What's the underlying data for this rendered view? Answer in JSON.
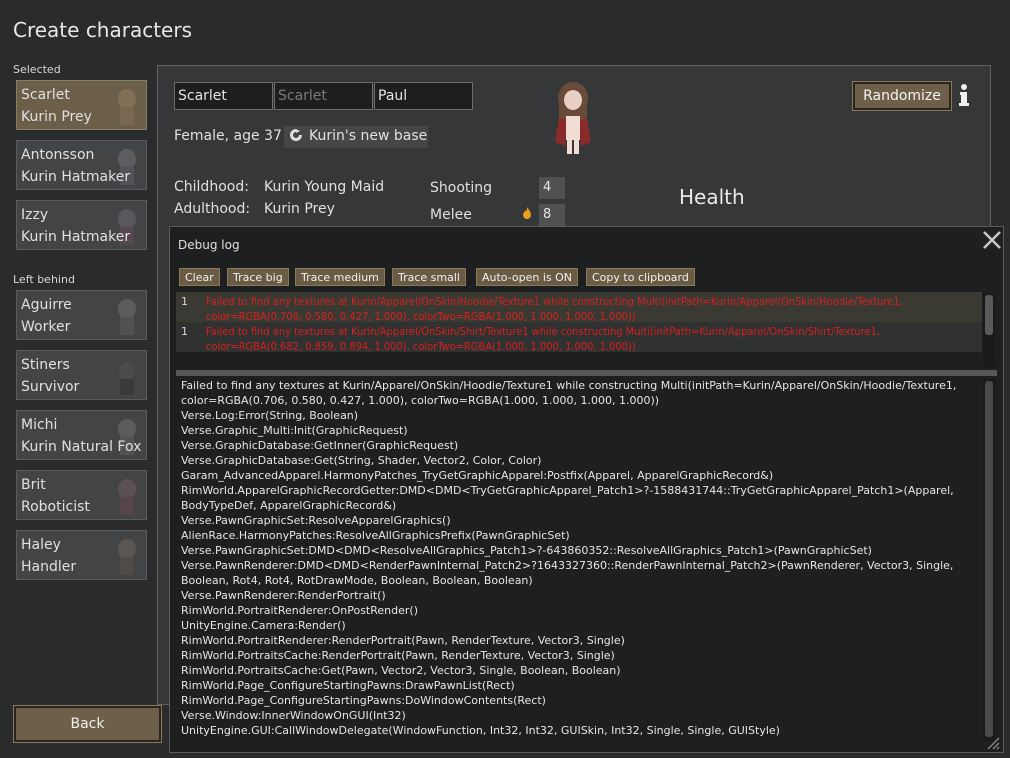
{
  "page": {
    "title": "Create characters"
  },
  "sidebar": {
    "selected_label": "Selected",
    "left_behind_label": "Left behind",
    "selected": [
      {
        "name": "Scarlet",
        "title": "Kurin Prey"
      },
      {
        "name": "Antonsson",
        "title": "Kurin Hatmaker"
      },
      {
        "name": "Izzy",
        "title": "Kurin Hatmaker"
      }
    ],
    "left_behind": [
      {
        "name": "Aguirre",
        "title": "Worker"
      },
      {
        "name": "Stiners",
        "title": "Survivor"
      },
      {
        "name": "Michi",
        "title": "Kurin Natural Fox"
      },
      {
        "name": "Brit",
        "title": "Roboticist"
      },
      {
        "name": "Haley",
        "title": "Handler"
      }
    ],
    "back_label": "Back"
  },
  "editor": {
    "first_name": "Scarlet",
    "nick_name_placeholder": "Scarlet",
    "last_name": "Paul",
    "gender_age": "Female, age 37",
    "faction": "Kurin's new base",
    "childhood_label": "Childhood:",
    "childhood_value": "Kurin Young Maid",
    "adulthood_label": "Adulthood:",
    "adulthood_value": "Kurin Prey",
    "skills": [
      {
        "label": "Shooting",
        "value": "4"
      },
      {
        "label": "Melee",
        "value": "8"
      }
    ],
    "randomize_label": "Randomize",
    "health_heading": "Health"
  },
  "debug": {
    "title": "Debug log",
    "buttons": [
      "Clear",
      "Trace big",
      "Trace medium",
      "Trace small",
      "Auto-open is ON",
      "Copy to clipboard"
    ],
    "messages": [
      {
        "count": "1",
        "text": "Failed to find any textures at Kurin/Apparel/OnSkin/Hoodie/Texture1 while constructing Multi(initPath=Kurin/Apparel/OnSkin/Hoodie/Texture1, color=RGBA(0.706, 0.580, 0.427, 1.000), colorTwo=RGBA(1.000, 1.000, 1.000, 1.000))"
      },
      {
        "count": "1",
        "text": "Failed to find any textures at Kurin/Apparel/OnSkin/Shirt/Texture1 while constructing Multi(initPath=Kurin/Apparel/OnSkin/Shirt/Texture1, color=RGBA(0.682, 0.859, 0.894, 1.000), colorTwo=RGBA(1.000, 1.000, 1.000, 1.000))"
      }
    ],
    "detail_lines": [
      "Failed to find any textures at Kurin/Apparel/OnSkin/Hoodie/Texture1 while constructing Multi(initPath=Kurin/Apparel/OnSkin/Hoodie/Texture1, color=RGBA(0.706, 0.580, 0.427, 1.000), colorTwo=RGBA(1.000, 1.000, 1.000, 1.000))",
      "Verse.Log:Error(String, Boolean)",
      "Verse.Graphic_Multi:Init(GraphicRequest)",
      "Verse.GraphicDatabase:GetInner(GraphicRequest)",
      "Verse.GraphicDatabase:Get(String, Shader, Vector2, Color, Color)",
      "Garam_AdvancedApparel.HarmonyPatches_TryGetGraphicApparel:Postfix(Apparel, ApparelGraphicRecord&)",
      "RimWorld.ApparelGraphicRecordGetter:DMD<DMD<TryGetGraphicApparel_Patch1>?-1588431744::TryGetGraphicApparel_Patch1>(Apparel, BodyTypeDef, ApparelGraphicRecord&)",
      "Verse.PawnGraphicSet:ResolveApparelGraphics()",
      "AlienRace.HarmonyPatches:ResolveAllGraphicsPrefix(PawnGraphicSet)",
      "Verse.PawnGraphicSet:DMD<DMD<ResolveAllGraphics_Patch1>?-643860352::ResolveAllGraphics_Patch1>(PawnGraphicSet)",
      "Verse.PawnRenderer:DMD<DMD<RenderPawnInternal_Patch2>?1643327360::RenderPawnInternal_Patch2>(PawnRenderer, Vector3, Single, Boolean, Rot4, Rot4, RotDrawMode, Boolean, Boolean, Boolean)",
      "Verse.PawnRenderer:RenderPortrait()",
      "RimWorld.PortraitRenderer:OnPostRender()",
      "UnityEngine.Camera:Render()",
      "RimWorld.PortraitRenderer:RenderPortrait(Pawn, RenderTexture, Vector3, Single)",
      "RimWorld.PortraitsCache:RenderPortrait(Pawn, RenderTexture, Vector3, Single)",
      "RimWorld.PortraitsCache:Get(Pawn, Vector2, Vector3, Single, Boolean, Boolean)",
      "RimWorld.Page_ConfigureStartingPawns:DrawPawnList(Rect)",
      "RimWorld.Page_ConfigureStartingPawns:DoWindowContents(Rect)",
      "Verse.Window:InnerWindowOnGUI(Int32)",
      "UnityEngine.GUI:CallWindowDelegate(WindowFunction, Int32, Int32, GUISkin, Int32, Single, Single, GUIStyle)"
    ]
  },
  "colors": {
    "background": "#2a2b2c",
    "button_gold": "#6e6048",
    "selected_card": "#6b5f49",
    "error_red": "#d62020"
  }
}
